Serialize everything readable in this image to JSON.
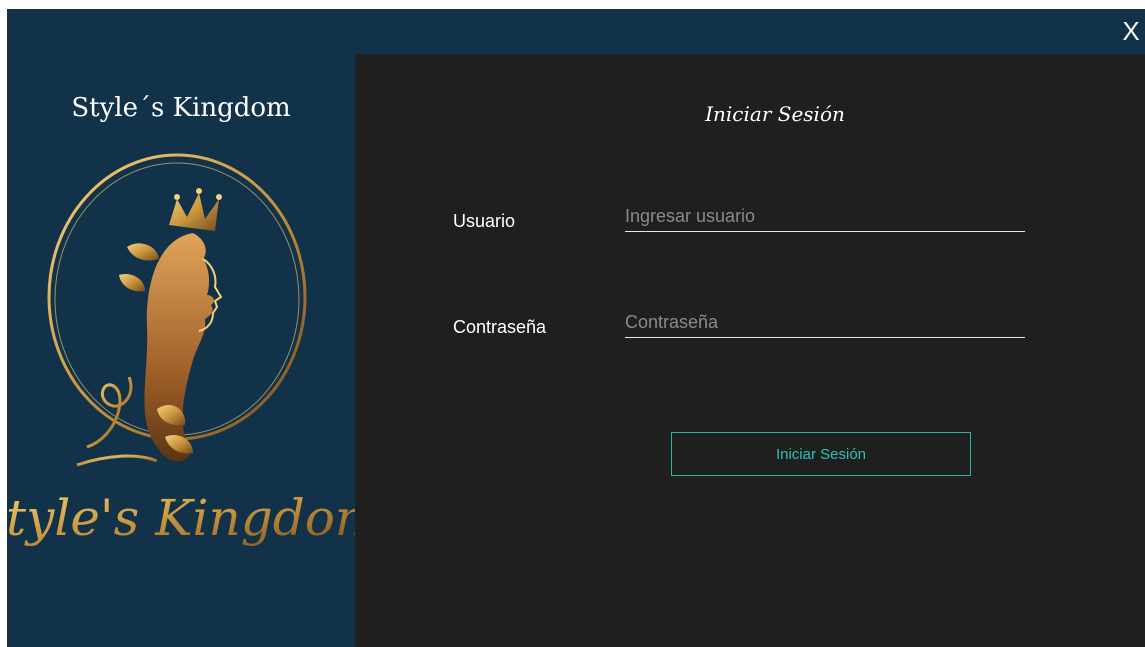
{
  "window": {
    "close_label": "X"
  },
  "brand": {
    "title": "Style´s Kingdom",
    "logo_script_text": "Style's Kingdom"
  },
  "login": {
    "title": "Iniciar Sesión",
    "username": {
      "label": "Usuario",
      "placeholder": "Ingresar usuario",
      "value": ""
    },
    "password": {
      "label": "Contraseña",
      "placeholder": "Contraseña",
      "value": ""
    },
    "submit_label": "Iniciar Sesión"
  },
  "colors": {
    "brand_panel": "#12324a",
    "main_panel": "#1f1f1f",
    "accent": "#2bb5a8",
    "gold": "#c8963e"
  }
}
